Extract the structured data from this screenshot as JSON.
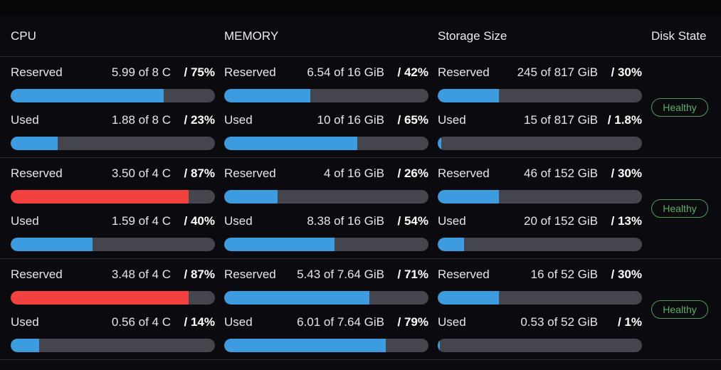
{
  "header": {
    "cpu": "CPU",
    "memory": "MEMORY",
    "storage": "Storage Size",
    "disk": "Disk State"
  },
  "labels": {
    "reserved": "Reserved",
    "used": "Used"
  },
  "colors": {
    "background": "#0b0b0f",
    "bar_track": "#45454d",
    "bar_normal": "#3d9bdf",
    "bar_danger": "#f2413f",
    "healthy": "#5fae66"
  },
  "rows": [
    {
      "cpu": {
        "reserved": {
          "amount": "5.99 of 8 C",
          "pct": "/ 75%",
          "fill": 0.75,
          "danger": false
        },
        "used": {
          "amount": "1.88 of 8 C",
          "pct": "/ 23%",
          "fill": 0.23,
          "danger": false
        }
      },
      "memory": {
        "reserved": {
          "amount": "6.54 of 16 GiB",
          "pct": "/ 42%",
          "fill": 0.42,
          "danger": false
        },
        "used": {
          "amount": "10 of 16 GiB",
          "pct": "/ 65%",
          "fill": 0.65,
          "danger": false
        }
      },
      "storage": {
        "reserved": {
          "amount": "245 of 817 GiB",
          "pct": "/ 30%",
          "fill": 0.3,
          "danger": false
        },
        "used": {
          "amount": "15 of 817 GiB",
          "pct": "/ 1.8%",
          "fill": 0.018,
          "danger": false
        }
      },
      "disk_state": "Healthy"
    },
    {
      "cpu": {
        "reserved": {
          "amount": "3.50 of 4 C",
          "pct": "/ 87%",
          "fill": 0.87,
          "danger": true
        },
        "used": {
          "amount": "1.59 of 4 C",
          "pct": "/ 40%",
          "fill": 0.4,
          "danger": false
        }
      },
      "memory": {
        "reserved": {
          "amount": "4 of 16 GiB",
          "pct": "/ 26%",
          "fill": 0.26,
          "danger": false
        },
        "used": {
          "amount": "8.38 of 16 GiB",
          "pct": "/ 54%",
          "fill": 0.54,
          "danger": false
        }
      },
      "storage": {
        "reserved": {
          "amount": "46 of 152 GiB",
          "pct": "/ 30%",
          "fill": 0.3,
          "danger": false
        },
        "used": {
          "amount": "20 of 152 GiB",
          "pct": "/ 13%",
          "fill": 0.13,
          "danger": false
        }
      },
      "disk_state": "Healthy"
    },
    {
      "cpu": {
        "reserved": {
          "amount": "3.48 of 4 C",
          "pct": "/ 87%",
          "fill": 0.87,
          "danger": true
        },
        "used": {
          "amount": "0.56 of 4 C",
          "pct": "/ 14%",
          "fill": 0.14,
          "danger": false
        }
      },
      "memory": {
        "reserved": {
          "amount": "5.43 of 7.64 GiB",
          "pct": "/ 71%",
          "fill": 0.71,
          "danger": false
        },
        "used": {
          "amount": "6.01 of 7.64 GiB",
          "pct": "/ 79%",
          "fill": 0.79,
          "danger": false
        }
      },
      "storage": {
        "reserved": {
          "amount": "16 of 52 GiB",
          "pct": "/ 30%",
          "fill": 0.3,
          "danger": false
        },
        "used": {
          "amount": "0.53 of 52 GiB",
          "pct": "/ 1%",
          "fill": 0.01,
          "danger": false
        }
      },
      "disk_state": "Healthy"
    }
  ]
}
